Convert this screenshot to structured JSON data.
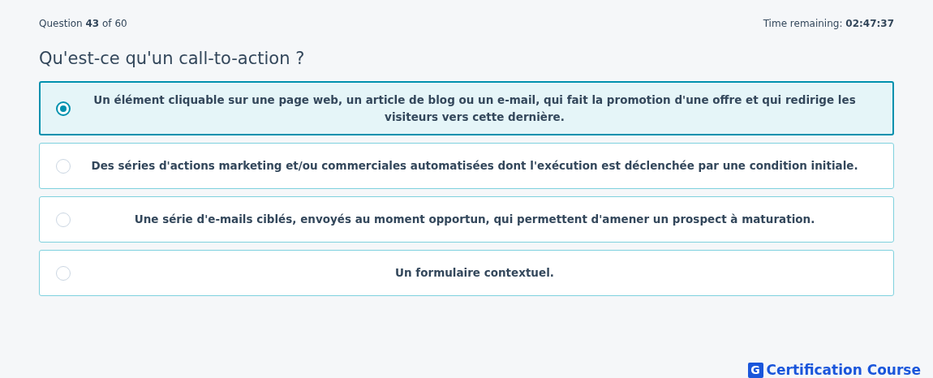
{
  "header": {
    "progress": "Question **43** of 60",
    "timer": "Time remaining: **02:47:37**"
  },
  "question": "Qu'est-ce qu'un call-to-action ?",
  "options": [
    {
      "text": "Un élément cliquable sur une page web, un article de blog ou un e-mail, qui fait la promotion d'une offre et qui redirige les visiteurs vers cette dernière.",
      "selected": true
    },
    {
      "text": "Des séries d'actions marketing et/ou commerciales automatisées dont l'exécution est déclenchée par une condition initiale.",
      "selected": false
    },
    {
      "text": "Une série d'e-mails ciblés, envoyés au moment opportun, qui permettent d'amener un prospect à maturation.",
      "selected": false
    },
    {
      "text": "Un formulaire contextuel.",
      "selected": false
    }
  ],
  "footer": {
    "logo_letter": "G",
    "brand": "Certification Course"
  }
}
